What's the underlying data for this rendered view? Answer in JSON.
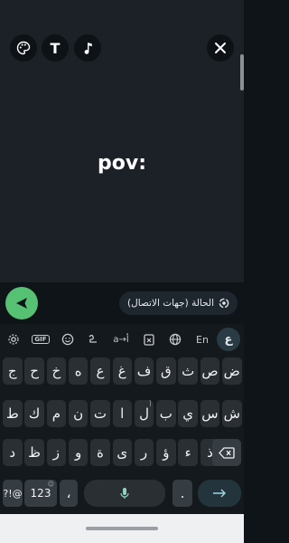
{
  "status_editor": {
    "text": "pov:",
    "colors": {
      "background": "#1b2127",
      "send_button": "#57c173"
    },
    "tools": [
      {
        "name": "palette-icon"
      },
      {
        "name": "text-style-icon",
        "label": "T"
      },
      {
        "name": "music-note-icon"
      }
    ],
    "close_icon": "close-icon"
  },
  "send_row": {
    "audience_label": "الحالة (جهات الاتصال)",
    "audience_icon": "status-ring-icon",
    "send_icon": "send-arrow-icon"
  },
  "keyboard": {
    "toolbar": {
      "gif": "GIF",
      "translit": "a→أ",
      "language": "En",
      "lang_key": "ع"
    },
    "row1": [
      "ض",
      "ص",
      "ث",
      "ق",
      "ف",
      "غ",
      "ع",
      "ه",
      "خ",
      "ح",
      "ج"
    ],
    "row1_hints": [
      "",
      "",
      "",
      "",
      "",
      "",
      "",
      "",
      "",
      "",
      ""
    ],
    "row2": [
      "ش",
      "س",
      "ي",
      "ب",
      "ل",
      "ا",
      "ت",
      "ن",
      "م",
      "ك",
      "ط"
    ],
    "row2_hints": [
      "",
      "",
      "",
      "",
      "أ",
      "",
      "",
      "",
      "",
      "",
      ""
    ],
    "row3": [
      "ذ",
      "ء",
      "ؤ",
      "ر",
      "ى",
      "ة",
      "و",
      "ز",
      "ظ",
      "د"
    ],
    "bottom": {
      "symbols": "?!@",
      "numbers": "123",
      "comma": "،",
      "period": ".",
      "emoji_hint": "☺"
    }
  }
}
